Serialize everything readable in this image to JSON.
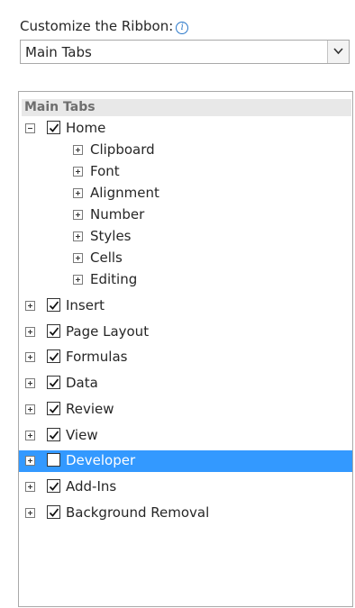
{
  "customize": {
    "label": "Customize the Ribbon:",
    "info_icon": "info-icon"
  },
  "dropdown": {
    "value": "Main Tabs",
    "button_icon": "chevron-down-icon"
  },
  "tree": {
    "header": "Main Tabs",
    "home": {
      "label": "Home",
      "checked": true,
      "expanded": true,
      "groups": [
        "Clipboard",
        "Font",
        "Alignment",
        "Number",
        "Styles",
        "Cells",
        "Editing"
      ]
    },
    "tabs": [
      {
        "label": "Insert",
        "checked": true,
        "selected": false
      },
      {
        "label": "Page Layout",
        "checked": true,
        "selected": false
      },
      {
        "label": "Formulas",
        "checked": true,
        "selected": false
      },
      {
        "label": "Data",
        "checked": true,
        "selected": false
      },
      {
        "label": "Review",
        "checked": true,
        "selected": false
      },
      {
        "label": "View",
        "checked": true,
        "selected": false
      },
      {
        "label": "Developer",
        "checked": false,
        "selected": true
      },
      {
        "label": "Add-Ins",
        "checked": true,
        "selected": false
      },
      {
        "label": "Background Removal",
        "checked": true,
        "selected": false
      }
    ]
  },
  "colors": {
    "selection": "#3399ff",
    "info": "#2b78c9"
  }
}
